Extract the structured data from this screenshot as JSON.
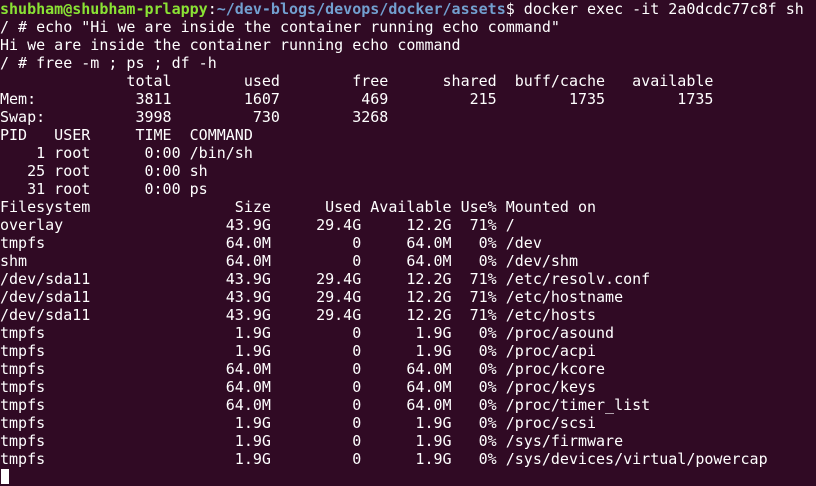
{
  "colors": {
    "background": "#300a24",
    "text": "#ffffff",
    "prompt_user": "#8ae234",
    "prompt_path": "#729fcf"
  },
  "prompt": {
    "user_host": "shubham@shubham-prlappy",
    "separator": ":",
    "path": "~/dev-blogs/devops/docker/assets",
    "symbol": "$ ",
    "command": "docker exec -it 2a0dcdc77c8f sh"
  },
  "lines": [
    "/ # echo \"Hi we are inside the container running echo command\"",
    "Hi we are inside the container running echo command",
    "/ # free -m ; ps ; df -h",
    "              total        used        free      shared  buff/cache   available",
    "Mem:           3811        1607         469         215        1735        1735",
    "Swap:          3998         730        3268",
    "PID   USER     TIME  COMMAND",
    "    1 root      0:00 /bin/sh",
    "   25 root      0:00 sh",
    "   31 root      0:00 ps",
    "Filesystem                Size      Used Available Use% Mounted on",
    "overlay                  43.9G     29.4G     12.2G  71% /",
    "tmpfs                    64.0M         0     64.0M   0% /dev",
    "shm                      64.0M         0     64.0M   0% /dev/shm",
    "/dev/sda11               43.9G     29.4G     12.2G  71% /etc/resolv.conf",
    "/dev/sda11               43.9G     29.4G     12.2G  71% /etc/hostname",
    "/dev/sda11               43.9G     29.4G     12.2G  71% /etc/hosts",
    "tmpfs                     1.9G         0      1.9G   0% /proc/asound",
    "tmpfs                     1.9G         0      1.9G   0% /proc/acpi",
    "tmpfs                    64.0M         0     64.0M   0% /proc/kcore",
    "tmpfs                    64.0M         0     64.0M   0% /proc/keys",
    "tmpfs                    64.0M         0     64.0M   0% /proc/timer_list",
    "tmpfs                     1.9G         0      1.9G   0% /proc/scsi",
    "tmpfs                     1.9G         0      1.9G   0% /sys/firmware",
    "tmpfs                     1.9G         0      1.9G   0% /sys/devices/virtual/powercap"
  ],
  "cursor": {
    "color": "#ffffff"
  }
}
